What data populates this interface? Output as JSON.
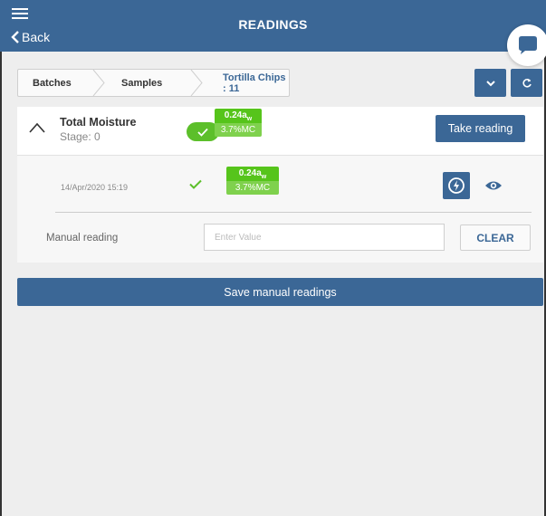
{
  "header": {
    "title": "READINGS",
    "back_label": "Back",
    "menu_icon": "hamburger-menu-icon"
  },
  "breadcrumb": [
    "Batches",
    "Samples",
    "Tortilla Chips : 11"
  ],
  "toolbar": {
    "dropdown_icon": "chevron-down-icon",
    "refresh_icon": "refresh-icon"
  },
  "sensor": {
    "name": "Total Moisture",
    "stage": "Stage: 0",
    "status_icon": "check-icon",
    "reading_aw": "0.24a",
    "reading_aw_sub": "w",
    "reading_mc": "3.7%MC",
    "take_reading_label": "Take reading"
  },
  "reading_row": {
    "timestamp": "14/Apr/2020 15:19",
    "reading_aw": "0.24a",
    "reading_aw_sub": "w",
    "reading_mc": "3.7%MC",
    "actions": [
      "flash-icon",
      "eye-icon"
    ]
  },
  "manual": {
    "label": "Manual reading",
    "placeholder": "Enter Value",
    "value": "",
    "clear_label": "CLEAR"
  },
  "save_label": "Save manual readings",
  "colors": {
    "primary": "#3b6796",
    "success": "#5cbf2a",
    "badge_light": "#7fd14d"
  }
}
